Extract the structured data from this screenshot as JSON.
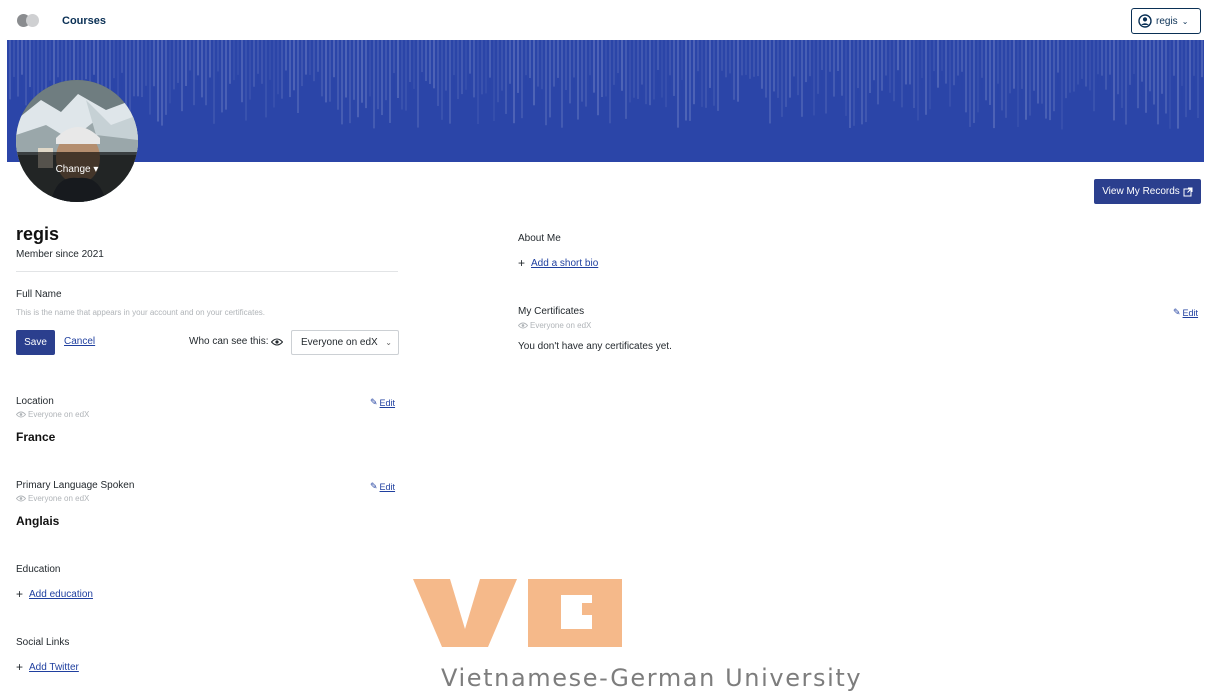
{
  "header": {
    "nav_courses": "Courses",
    "username": "regis"
  },
  "profile": {
    "avatar_change": "Change",
    "view_records": "View My Records",
    "username": "regis",
    "member_since": "Member since 2021"
  },
  "full_name": {
    "label": "Full Name",
    "hint": "This is the name that appears in your account and on your certificates.",
    "save": "Save",
    "cancel": "Cancel",
    "who_can_see": "Who can see this:",
    "visibility_selected": "Everyone on edX"
  },
  "location": {
    "label": "Location",
    "visibility": "Everyone on edX",
    "value": "France",
    "edit": "Edit"
  },
  "language": {
    "label": "Primary Language Spoken",
    "visibility": "Everyone on edX",
    "value": "Anglais",
    "edit": "Edit"
  },
  "education": {
    "label": "Education",
    "add": "Add education"
  },
  "social": {
    "label": "Social Links",
    "add": "Add Twitter"
  },
  "about": {
    "label": "About Me",
    "add": "Add a short bio"
  },
  "certificates": {
    "label": "My Certificates",
    "visibility": "Everyone on edX",
    "edit": "Edit",
    "empty": "You don't have any certificates yet."
  },
  "watermark": {
    "logo_text": "VGU",
    "text": "Vietnamese-German University"
  },
  "colors": {
    "banner": "#2b45a8",
    "primary_button": "#2b3f8e",
    "link": "#1f3f9f",
    "watermark_orange": "#f5b98a"
  }
}
